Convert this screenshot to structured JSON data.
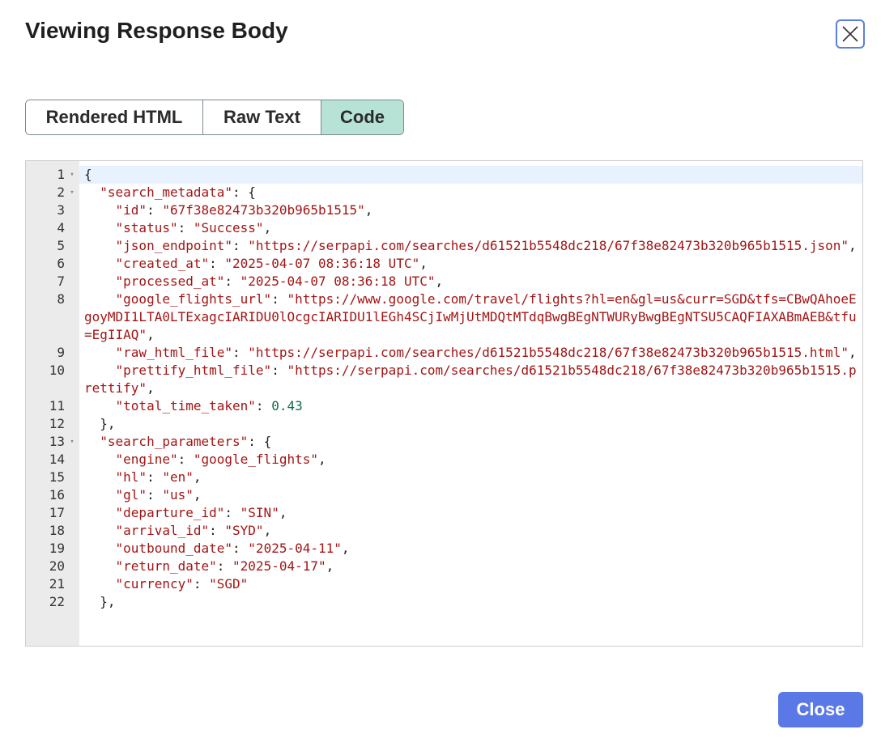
{
  "modal": {
    "title": "Viewing Response Body",
    "close_label": "Close"
  },
  "tabs": [
    {
      "label": "Rendered HTML",
      "active": false
    },
    {
      "label": "Raw Text",
      "active": false
    },
    {
      "label": "Code",
      "active": true
    }
  ],
  "editor": {
    "lines": [
      {
        "num": "1",
        "fold": true,
        "tokens": [
          {
            "t": "p",
            "v": "{"
          }
        ]
      },
      {
        "num": "2",
        "fold": true,
        "tokens": [
          {
            "t": "p",
            "v": "  "
          },
          {
            "t": "k",
            "v": "\"search_metadata\""
          },
          {
            "t": "p",
            "v": ": {"
          }
        ]
      },
      {
        "num": "3",
        "fold": false,
        "tokens": [
          {
            "t": "p",
            "v": "    "
          },
          {
            "t": "k",
            "v": "\"id\""
          },
          {
            "t": "p",
            "v": ": "
          },
          {
            "t": "s",
            "v": "\"67f38e82473b320b965b1515\""
          },
          {
            "t": "p",
            "v": ","
          }
        ]
      },
      {
        "num": "4",
        "fold": false,
        "tokens": [
          {
            "t": "p",
            "v": "    "
          },
          {
            "t": "k",
            "v": "\"status\""
          },
          {
            "t": "p",
            "v": ": "
          },
          {
            "t": "s",
            "v": "\"Success\""
          },
          {
            "t": "p",
            "v": ","
          }
        ]
      },
      {
        "num": "5",
        "fold": false,
        "tokens": [
          {
            "t": "p",
            "v": "    "
          },
          {
            "t": "k",
            "v": "\"json_endpoint\""
          },
          {
            "t": "p",
            "v": ": "
          },
          {
            "t": "s",
            "v": "\"https://serpapi.com/searches/d61521b5548dc218/67f38e82473b320b965b1515.json\""
          },
          {
            "t": "p",
            "v": ","
          }
        ]
      },
      {
        "num": "6",
        "fold": false,
        "tokens": [
          {
            "t": "p",
            "v": "    "
          },
          {
            "t": "k",
            "v": "\"created_at\""
          },
          {
            "t": "p",
            "v": ": "
          },
          {
            "t": "s",
            "v": "\"2025-04-07 08:36:18 UTC\""
          },
          {
            "t": "p",
            "v": ","
          }
        ]
      },
      {
        "num": "7",
        "fold": false,
        "tokens": [
          {
            "t": "p",
            "v": "    "
          },
          {
            "t": "k",
            "v": "\"processed_at\""
          },
          {
            "t": "p",
            "v": ": "
          },
          {
            "t": "s",
            "v": "\"2025-04-07 08:36:18 UTC\""
          },
          {
            "t": "p",
            "v": ","
          }
        ]
      },
      {
        "num": "8",
        "fold": false,
        "tokens": [
          {
            "t": "p",
            "v": "    "
          },
          {
            "t": "k",
            "v": "\"google_flights_url\""
          },
          {
            "t": "p",
            "v": ": "
          },
          {
            "t": "s",
            "v": "\"https://www.google.com/travel/flights?hl=en&gl=us&curr=SGD&tfs=CBwQAhoeEgoyMDI1LTA0LTExagcIARIDU0lOcgcIARIDU1lEGh4SCjIwMjUtMDQtMTdqBwgBEgNTWURyBwgBEgNTSU5CAQFIAXABmAEB&tfu=EgIIAQ\""
          },
          {
            "t": "p",
            "v": ","
          }
        ]
      },
      {
        "num": "9",
        "fold": false,
        "tokens": [
          {
            "t": "p",
            "v": "    "
          },
          {
            "t": "k",
            "v": "\"raw_html_file\""
          },
          {
            "t": "p",
            "v": ": "
          },
          {
            "t": "s",
            "v": "\"https://serpapi.com/searches/d61521b5548dc218/67f38e82473b320b965b1515.html\""
          },
          {
            "t": "p",
            "v": ","
          }
        ]
      },
      {
        "num": "10",
        "fold": false,
        "tokens": [
          {
            "t": "p",
            "v": "    "
          },
          {
            "t": "k",
            "v": "\"prettify_html_file\""
          },
          {
            "t": "p",
            "v": ": "
          },
          {
            "t": "s",
            "v": "\"https://serpapi.com/searches/d61521b5548dc218/67f38e82473b320b965b1515.prettify\""
          },
          {
            "t": "p",
            "v": ","
          }
        ]
      },
      {
        "num": "11",
        "fold": false,
        "tokens": [
          {
            "t": "p",
            "v": "    "
          },
          {
            "t": "k",
            "v": "\"total_time_taken\""
          },
          {
            "t": "p",
            "v": ": "
          },
          {
            "t": "n",
            "v": "0.43"
          }
        ]
      },
      {
        "num": "12",
        "fold": false,
        "tokens": [
          {
            "t": "p",
            "v": "  },"
          }
        ]
      },
      {
        "num": "13",
        "fold": true,
        "tokens": [
          {
            "t": "p",
            "v": "  "
          },
          {
            "t": "k",
            "v": "\"search_parameters\""
          },
          {
            "t": "p",
            "v": ": {"
          }
        ]
      },
      {
        "num": "14",
        "fold": false,
        "tokens": [
          {
            "t": "p",
            "v": "    "
          },
          {
            "t": "k",
            "v": "\"engine\""
          },
          {
            "t": "p",
            "v": ": "
          },
          {
            "t": "s",
            "v": "\"google_flights\""
          },
          {
            "t": "p",
            "v": ","
          }
        ]
      },
      {
        "num": "15",
        "fold": false,
        "tokens": [
          {
            "t": "p",
            "v": "    "
          },
          {
            "t": "k",
            "v": "\"hl\""
          },
          {
            "t": "p",
            "v": ": "
          },
          {
            "t": "s",
            "v": "\"en\""
          },
          {
            "t": "p",
            "v": ","
          }
        ]
      },
      {
        "num": "16",
        "fold": false,
        "tokens": [
          {
            "t": "p",
            "v": "    "
          },
          {
            "t": "k",
            "v": "\"gl\""
          },
          {
            "t": "p",
            "v": ": "
          },
          {
            "t": "s",
            "v": "\"us\""
          },
          {
            "t": "p",
            "v": ","
          }
        ]
      },
      {
        "num": "17",
        "fold": false,
        "tokens": [
          {
            "t": "p",
            "v": "    "
          },
          {
            "t": "k",
            "v": "\"departure_id\""
          },
          {
            "t": "p",
            "v": ": "
          },
          {
            "t": "s",
            "v": "\"SIN\""
          },
          {
            "t": "p",
            "v": ","
          }
        ]
      },
      {
        "num": "18",
        "fold": false,
        "tokens": [
          {
            "t": "p",
            "v": "    "
          },
          {
            "t": "k",
            "v": "\"arrival_id\""
          },
          {
            "t": "p",
            "v": ": "
          },
          {
            "t": "s",
            "v": "\"SYD\""
          },
          {
            "t": "p",
            "v": ","
          }
        ]
      },
      {
        "num": "19",
        "fold": false,
        "tokens": [
          {
            "t": "p",
            "v": "    "
          },
          {
            "t": "k",
            "v": "\"outbound_date\""
          },
          {
            "t": "p",
            "v": ": "
          },
          {
            "t": "s",
            "v": "\"2025-04-11\""
          },
          {
            "t": "p",
            "v": ","
          }
        ]
      },
      {
        "num": "20",
        "fold": false,
        "tokens": [
          {
            "t": "p",
            "v": "    "
          },
          {
            "t": "k",
            "v": "\"return_date\""
          },
          {
            "t": "p",
            "v": ": "
          },
          {
            "t": "s",
            "v": "\"2025-04-17\""
          },
          {
            "t": "p",
            "v": ","
          }
        ]
      },
      {
        "num": "21",
        "fold": false,
        "tokens": [
          {
            "t": "p",
            "v": "    "
          },
          {
            "t": "k",
            "v": "\"currency\""
          },
          {
            "t": "p",
            "v": ": "
          },
          {
            "t": "s",
            "v": "\"SGD\""
          }
        ]
      },
      {
        "num": "22",
        "fold": false,
        "tokens": [
          {
            "t": "p",
            "v": "  },"
          }
        ]
      }
    ]
  },
  "colors": {
    "accent": "#5a78e6",
    "active_tab": "#b7e2d6",
    "string": "#a31515",
    "number": "#0b6b4d"
  }
}
